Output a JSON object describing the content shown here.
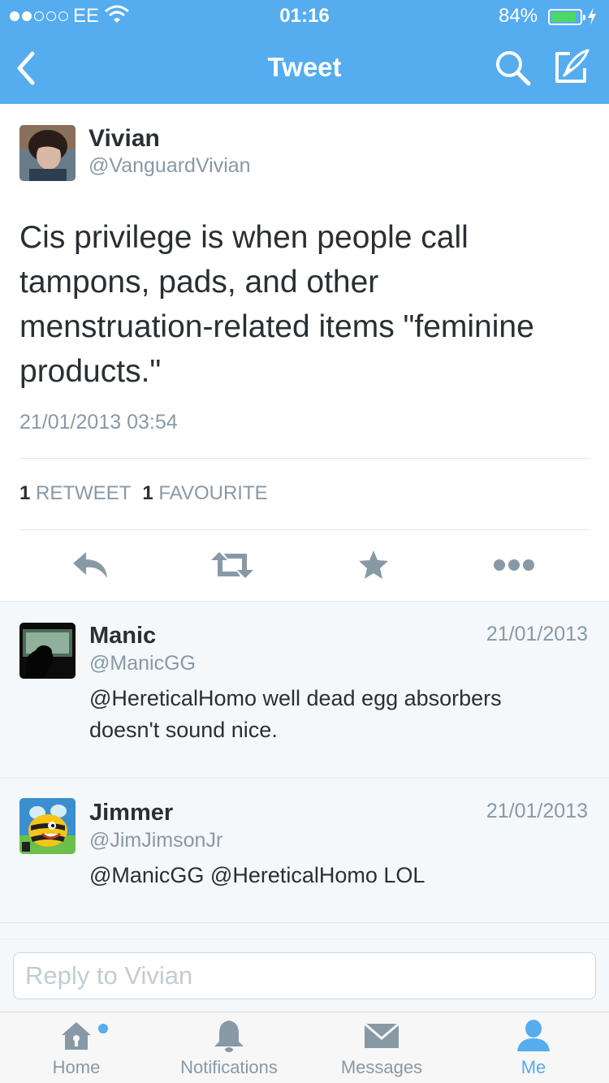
{
  "status_bar": {
    "carrier": "EE",
    "time": "01:16",
    "battery_percent": "84%",
    "signal_bars_filled": 2,
    "signal_bars_total": 5,
    "battery_level": 0.84
  },
  "nav": {
    "title": "Tweet",
    "back_icon": "chevron-left-icon",
    "search_icon": "search-icon",
    "compose_icon": "compose-icon"
  },
  "tweet": {
    "author_name": "Vivian",
    "author_handle": "@VanguardVivian",
    "text": "Cis privilege is when people call tampons, pads, and other menstruation-related items \"feminine products.\"",
    "timestamp": "21/01/2013 03:54",
    "retweet_count": "1",
    "retweet_label": "RETWEET",
    "favourite_count": "1",
    "favourite_label": "FAVOURITE",
    "actions": [
      "reply-icon",
      "retweet-icon",
      "favourite-icon",
      "more-icon"
    ]
  },
  "replies": [
    {
      "name": "Manic",
      "handle": "@ManicGG",
      "date": "21/01/2013",
      "text": "@HereticalHomo well dead egg absorbers doesn't sound nice."
    },
    {
      "name": "Jimmer",
      "handle": "@JimJimsonJr",
      "date": "21/01/2013",
      "text": "@ManicGG @HereticalHomo LOL"
    }
  ],
  "reply_box": {
    "placeholder": "Reply to Vivian",
    "value": ""
  },
  "tabbar": {
    "items": [
      {
        "label": "Home",
        "icon": "home-icon",
        "active": false,
        "badge": true
      },
      {
        "label": "Notifications",
        "icon": "bell-icon",
        "active": false,
        "badge": false
      },
      {
        "label": "Messages",
        "icon": "envelope-icon",
        "active": false,
        "badge": false
      },
      {
        "label": "Me",
        "icon": "person-icon",
        "active": true,
        "badge": false
      }
    ]
  },
  "colors": {
    "brand": "#55acee",
    "text": "#292f33",
    "secondary": "#8899a6",
    "battery": "#4cd964"
  }
}
